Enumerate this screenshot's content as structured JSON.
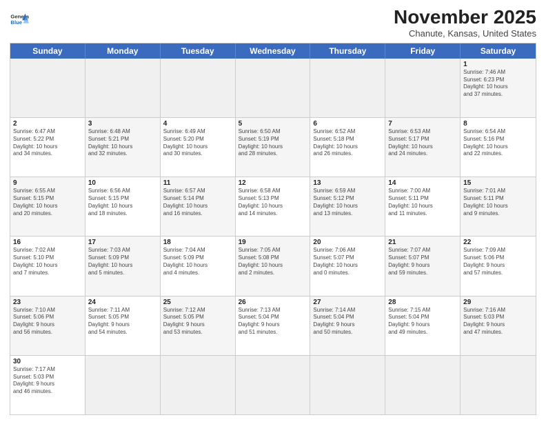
{
  "header": {
    "logo_general": "General",
    "logo_blue": "Blue",
    "month_title": "November 2025",
    "location": "Chanute, Kansas, United States"
  },
  "days_of_week": [
    "Sunday",
    "Monday",
    "Tuesday",
    "Wednesday",
    "Thursday",
    "Friday",
    "Saturday"
  ],
  "rows": [
    [
      {
        "num": "",
        "info": "",
        "empty": true
      },
      {
        "num": "",
        "info": "",
        "empty": true
      },
      {
        "num": "",
        "info": "",
        "empty": true
      },
      {
        "num": "",
        "info": "",
        "empty": true
      },
      {
        "num": "",
        "info": "",
        "empty": true
      },
      {
        "num": "",
        "info": "",
        "empty": true
      },
      {
        "num": "1",
        "info": "Sunrise: 7:46 AM\nSunset: 6:23 PM\nDaylight: 10 hours\nand 37 minutes.",
        "shaded": true
      }
    ],
    [
      {
        "num": "2",
        "info": "Sunrise: 6:47 AM\nSunset: 5:22 PM\nDaylight: 10 hours\nand 34 minutes."
      },
      {
        "num": "3",
        "info": "Sunrise: 6:48 AM\nSunset: 5:21 PM\nDaylight: 10 hours\nand 32 minutes.",
        "shaded": true
      },
      {
        "num": "4",
        "info": "Sunrise: 6:49 AM\nSunset: 5:20 PM\nDaylight: 10 hours\nand 30 minutes."
      },
      {
        "num": "5",
        "info": "Sunrise: 6:50 AM\nSunset: 5:19 PM\nDaylight: 10 hours\nand 28 minutes.",
        "shaded": true
      },
      {
        "num": "6",
        "info": "Sunrise: 6:52 AM\nSunset: 5:18 PM\nDaylight: 10 hours\nand 26 minutes."
      },
      {
        "num": "7",
        "info": "Sunrise: 6:53 AM\nSunset: 5:17 PM\nDaylight: 10 hours\nand 24 minutes.",
        "shaded": true
      },
      {
        "num": "8",
        "info": "Sunrise: 6:54 AM\nSunset: 5:16 PM\nDaylight: 10 hours\nand 22 minutes."
      }
    ],
    [
      {
        "num": "9",
        "info": "Sunrise: 6:55 AM\nSunset: 5:15 PM\nDaylight: 10 hours\nand 20 minutes.",
        "shaded": true
      },
      {
        "num": "10",
        "info": "Sunrise: 6:56 AM\nSunset: 5:15 PM\nDaylight: 10 hours\nand 18 minutes."
      },
      {
        "num": "11",
        "info": "Sunrise: 6:57 AM\nSunset: 5:14 PM\nDaylight: 10 hours\nand 16 minutes.",
        "shaded": true
      },
      {
        "num": "12",
        "info": "Sunrise: 6:58 AM\nSunset: 5:13 PM\nDaylight: 10 hours\nand 14 minutes."
      },
      {
        "num": "13",
        "info": "Sunrise: 6:59 AM\nSunset: 5:12 PM\nDaylight: 10 hours\nand 13 minutes.",
        "shaded": true
      },
      {
        "num": "14",
        "info": "Sunrise: 7:00 AM\nSunset: 5:11 PM\nDaylight: 10 hours\nand 11 minutes."
      },
      {
        "num": "15",
        "info": "Sunrise: 7:01 AM\nSunset: 5:11 PM\nDaylight: 10 hours\nand 9 minutes.",
        "shaded": true
      }
    ],
    [
      {
        "num": "16",
        "info": "Sunrise: 7:02 AM\nSunset: 5:10 PM\nDaylight: 10 hours\nand 7 minutes."
      },
      {
        "num": "17",
        "info": "Sunrise: 7:03 AM\nSunset: 5:09 PM\nDaylight: 10 hours\nand 5 minutes.",
        "shaded": true
      },
      {
        "num": "18",
        "info": "Sunrise: 7:04 AM\nSunset: 5:09 PM\nDaylight: 10 hours\nand 4 minutes."
      },
      {
        "num": "19",
        "info": "Sunrise: 7:05 AM\nSunset: 5:08 PM\nDaylight: 10 hours\nand 2 minutes.",
        "shaded": true
      },
      {
        "num": "20",
        "info": "Sunrise: 7:06 AM\nSunset: 5:07 PM\nDaylight: 10 hours\nand 0 minutes."
      },
      {
        "num": "21",
        "info": "Sunrise: 7:07 AM\nSunset: 5:07 PM\nDaylight: 9 hours\nand 59 minutes.",
        "shaded": true
      },
      {
        "num": "22",
        "info": "Sunrise: 7:09 AM\nSunset: 5:06 PM\nDaylight: 9 hours\nand 57 minutes."
      }
    ],
    [
      {
        "num": "23",
        "info": "Sunrise: 7:10 AM\nSunset: 5:06 PM\nDaylight: 9 hours\nand 56 minutes.",
        "shaded": true
      },
      {
        "num": "24",
        "info": "Sunrise: 7:11 AM\nSunset: 5:05 PM\nDaylight: 9 hours\nand 54 minutes."
      },
      {
        "num": "25",
        "info": "Sunrise: 7:12 AM\nSunset: 5:05 PM\nDaylight: 9 hours\nand 53 minutes.",
        "shaded": true
      },
      {
        "num": "26",
        "info": "Sunrise: 7:13 AM\nSunset: 5:04 PM\nDaylight: 9 hours\nand 51 minutes."
      },
      {
        "num": "27",
        "info": "Sunrise: 7:14 AM\nSunset: 5:04 PM\nDaylight: 9 hours\nand 50 minutes.",
        "shaded": true
      },
      {
        "num": "28",
        "info": "Sunrise: 7:15 AM\nSunset: 5:04 PM\nDaylight: 9 hours\nand 49 minutes."
      },
      {
        "num": "29",
        "info": "Sunrise: 7:16 AM\nSunset: 5:03 PM\nDaylight: 9 hours\nand 47 minutes.",
        "shaded": true
      }
    ],
    [
      {
        "num": "30",
        "info": "Sunrise: 7:17 AM\nSunset: 5:03 PM\nDaylight: 9 hours\nand 46 minutes."
      },
      {
        "num": "",
        "info": "",
        "empty": true
      },
      {
        "num": "",
        "info": "",
        "empty": true
      },
      {
        "num": "",
        "info": "",
        "empty": true
      },
      {
        "num": "",
        "info": "",
        "empty": true
      },
      {
        "num": "",
        "info": "",
        "empty": true
      },
      {
        "num": "",
        "info": "",
        "empty": true
      }
    ]
  ]
}
